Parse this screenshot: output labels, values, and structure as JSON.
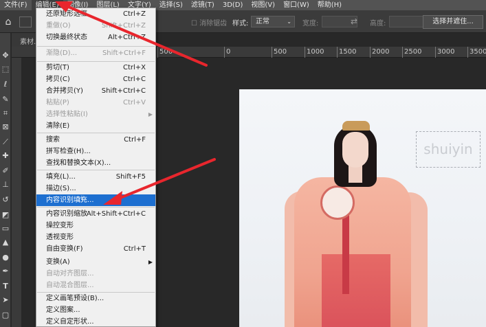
{
  "menubar": {
    "items": [
      "文件(F)",
      "编辑(E)",
      "图像(I)",
      "图层(L)",
      "文字(Y)",
      "选择(S)",
      "滤镜(T)",
      "3D(D)",
      "视图(V)",
      "窗口(W)",
      "帮助(H)"
    ]
  },
  "optionsbar": {
    "faded_label": "消除锯齿",
    "style_label": "样式:",
    "style_value": "正常",
    "width_label": "宽度:",
    "height_label": "高度:",
    "mask_button": "选择并遮住..."
  },
  "document": {
    "tab_label": "素材..."
  },
  "ruler": {
    "ticks": [
      "500",
      "0",
      "500",
      "1000",
      "1500",
      "2000",
      "2500",
      "3000",
      "3500"
    ]
  },
  "photo": {
    "watermark_text": "shuiyin"
  },
  "edit_menu": {
    "items": [
      {
        "label": "还原矩形选框",
        "shortcut": "Ctrl+Z",
        "disabled": false
      },
      {
        "label": "重做(O)",
        "shortcut": "Shift+Ctrl+Z",
        "disabled": true
      },
      {
        "label": "切换最终状态",
        "shortcut": "Alt+Ctrl+Z",
        "disabled": false
      },
      {
        "label": "渐隐(D)...",
        "shortcut": "Shift+Ctrl+F",
        "disabled": true
      },
      {
        "label": "剪切(T)",
        "shortcut": "Ctrl+X",
        "disabled": false
      },
      {
        "label": "拷贝(C)",
        "shortcut": "Ctrl+C",
        "disabled": false
      },
      {
        "label": "合并拷贝(Y)",
        "shortcut": "Shift+Ctrl+C",
        "disabled": false
      },
      {
        "label": "粘贴(P)",
        "shortcut": "Ctrl+V",
        "disabled": true
      },
      {
        "label": "选择性粘贴(I)",
        "shortcut": "",
        "disabled": true,
        "submenu": true
      },
      {
        "label": "清除(E)",
        "shortcut": "",
        "disabled": false
      },
      {
        "label": "搜索",
        "shortcut": "Ctrl+F",
        "disabled": false
      },
      {
        "label": "拼写检查(H)...",
        "shortcut": "",
        "disabled": false
      },
      {
        "label": "查找和替换文本(X)...",
        "shortcut": "",
        "disabled": false
      },
      {
        "label": "填充(L)...",
        "shortcut": "Shift+F5",
        "disabled": false
      },
      {
        "label": "描边(S)...",
        "shortcut": "",
        "disabled": false
      },
      {
        "label": "内容识别填充...",
        "shortcut": "",
        "disabled": false,
        "highlight": true
      },
      {
        "label": "内容识别缩放",
        "shortcut": "Alt+Shift+Ctrl+C",
        "disabled": false
      },
      {
        "label": "操控变形",
        "shortcut": "",
        "disabled": false
      },
      {
        "label": "透视变形",
        "shortcut": "",
        "disabled": false
      },
      {
        "label": "自由变换(F)",
        "shortcut": "Ctrl+T",
        "disabled": false
      },
      {
        "label": "变换(A)",
        "shortcut": "",
        "disabled": false,
        "submenu": true
      },
      {
        "label": "自动对齐图层...",
        "shortcut": "",
        "disabled": true
      },
      {
        "label": "自动混合图层...",
        "shortcut": "",
        "disabled": true
      },
      {
        "label": "定义画笔预设(B)...",
        "shortcut": "",
        "disabled": false
      },
      {
        "label": "定义图案...",
        "shortcut": "",
        "disabled": false
      },
      {
        "label": "定义自定形状...",
        "shortcut": "",
        "disabled": false
      }
    ]
  },
  "colors": {
    "highlight": "#1d6fd0",
    "arrow": "#e8262d",
    "menubar_bg": "#535353",
    "menu_bg": "#f0f0f0"
  }
}
